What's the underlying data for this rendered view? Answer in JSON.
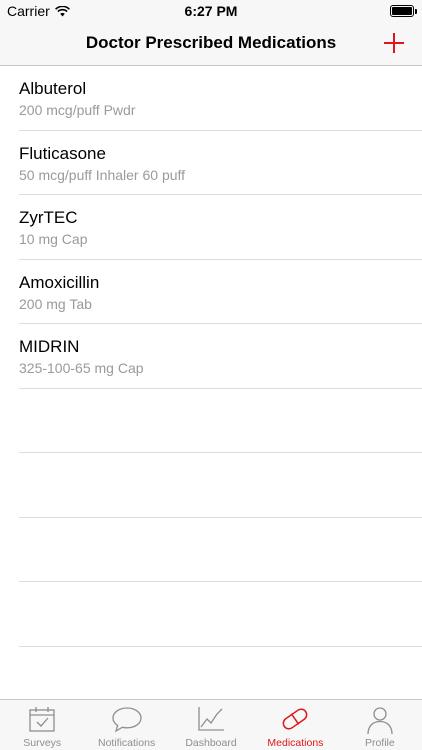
{
  "status_bar": {
    "carrier": "Carrier",
    "time": "6:27 PM"
  },
  "nav": {
    "title": "Doctor Prescribed Medications",
    "add_icon": "plus-icon"
  },
  "medications": [
    {
      "name": "Albuterol",
      "dose": "200 mcg/puff Pwdr"
    },
    {
      "name": "Fluticasone",
      "dose": "50 mcg/puff Inhaler 60 puff"
    },
    {
      "name": "ZyrTEC",
      "dose": "10 mg Cap"
    },
    {
      "name": "Amoxicillin",
      "dose": "200 mg Tab"
    },
    {
      "name": "MIDRIN",
      "dose": "325-100-65 mg Cap"
    }
  ],
  "tabs": [
    {
      "label": "Surveys",
      "icon": "calendar-icon",
      "active": false
    },
    {
      "label": "Notifications",
      "icon": "speech-bubble-icon",
      "active": false
    },
    {
      "label": "Dashboard",
      "icon": "line-chart-icon",
      "active": false
    },
    {
      "label": "Medications",
      "icon": "pill-icon",
      "active": true
    },
    {
      "label": "Profile",
      "icon": "person-icon",
      "active": false
    }
  ],
  "colors": {
    "accent": "#e0161b",
    "inactive": "#8e8e93",
    "bar_background": "#f7f7f7",
    "separator": "#dcdcdf"
  }
}
